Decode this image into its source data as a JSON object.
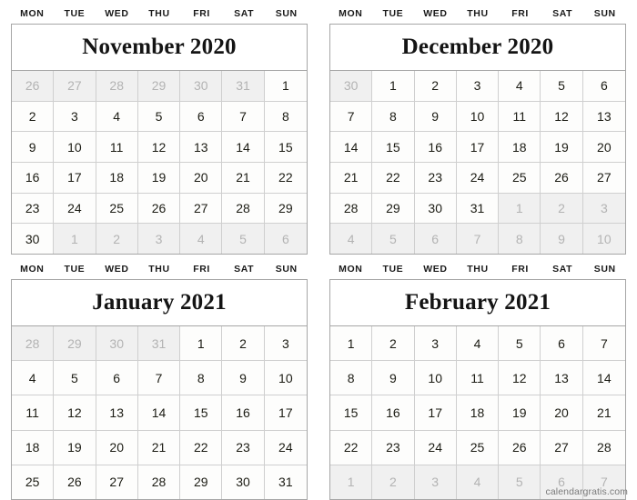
{
  "weekdays": [
    "MON",
    "TUE",
    "WED",
    "THU",
    "FRI",
    "SAT",
    "SUN"
  ],
  "watermark": "calendargratis.com",
  "colors": {
    "box_border": "#a6a6a6",
    "cell_border": "#cfcfcf",
    "out_of_month_bg": "#f0f0f0",
    "out_of_month_text": "#b3b3b3",
    "in_month_text": "#1c1c14",
    "title_text": "#141414",
    "page_bg": "#ffffff",
    "watermark_text": "#7a7a7a"
  },
  "months": [
    {
      "id": "november-2020",
      "title": "November 2020",
      "month_name": "November",
      "year": "2020",
      "weeks": [
        [
          {
            "n": "26",
            "out": true
          },
          {
            "n": "27",
            "out": true
          },
          {
            "n": "28",
            "out": true
          },
          {
            "n": "29",
            "out": true
          },
          {
            "n": "30",
            "out": true
          },
          {
            "n": "31",
            "out": true
          },
          {
            "n": "1",
            "out": false
          }
        ],
        [
          {
            "n": "2",
            "out": false
          },
          {
            "n": "3",
            "out": false
          },
          {
            "n": "4",
            "out": false
          },
          {
            "n": "5",
            "out": false
          },
          {
            "n": "6",
            "out": false
          },
          {
            "n": "7",
            "out": false
          },
          {
            "n": "8",
            "out": false
          }
        ],
        [
          {
            "n": "9",
            "out": false
          },
          {
            "n": "10",
            "out": false
          },
          {
            "n": "11",
            "out": false
          },
          {
            "n": "12",
            "out": false
          },
          {
            "n": "13",
            "out": false
          },
          {
            "n": "14",
            "out": false
          },
          {
            "n": "15",
            "out": false
          }
        ],
        [
          {
            "n": "16",
            "out": false
          },
          {
            "n": "17",
            "out": false
          },
          {
            "n": "18",
            "out": false
          },
          {
            "n": "19",
            "out": false
          },
          {
            "n": "20",
            "out": false
          },
          {
            "n": "21",
            "out": false
          },
          {
            "n": "22",
            "out": false
          }
        ],
        [
          {
            "n": "23",
            "out": false
          },
          {
            "n": "24",
            "out": false
          },
          {
            "n": "25",
            "out": false
          },
          {
            "n": "26",
            "out": false
          },
          {
            "n": "27",
            "out": false
          },
          {
            "n": "28",
            "out": false
          },
          {
            "n": "29",
            "out": false
          }
        ],
        [
          {
            "n": "30",
            "out": false
          },
          {
            "n": "1",
            "out": true
          },
          {
            "n": "2",
            "out": true
          },
          {
            "n": "3",
            "out": true
          },
          {
            "n": "4",
            "out": true
          },
          {
            "n": "5",
            "out": true
          },
          {
            "n": "6",
            "out": true
          }
        ]
      ]
    },
    {
      "id": "december-2020",
      "title": "December 2020",
      "month_name": "December",
      "year": "2020",
      "weeks": [
        [
          {
            "n": "30",
            "out": true
          },
          {
            "n": "1",
            "out": false
          },
          {
            "n": "2",
            "out": false
          },
          {
            "n": "3",
            "out": false
          },
          {
            "n": "4",
            "out": false
          },
          {
            "n": "5",
            "out": false
          },
          {
            "n": "6",
            "out": false
          }
        ],
        [
          {
            "n": "7",
            "out": false
          },
          {
            "n": "8",
            "out": false
          },
          {
            "n": "9",
            "out": false
          },
          {
            "n": "10",
            "out": false
          },
          {
            "n": "11",
            "out": false
          },
          {
            "n": "12",
            "out": false
          },
          {
            "n": "13",
            "out": false
          }
        ],
        [
          {
            "n": "14",
            "out": false
          },
          {
            "n": "15",
            "out": false
          },
          {
            "n": "16",
            "out": false
          },
          {
            "n": "17",
            "out": false
          },
          {
            "n": "18",
            "out": false
          },
          {
            "n": "19",
            "out": false
          },
          {
            "n": "20",
            "out": false
          }
        ],
        [
          {
            "n": "21",
            "out": false
          },
          {
            "n": "22",
            "out": false
          },
          {
            "n": "23",
            "out": false
          },
          {
            "n": "24",
            "out": false
          },
          {
            "n": "25",
            "out": false
          },
          {
            "n": "26",
            "out": false
          },
          {
            "n": "27",
            "out": false
          }
        ],
        [
          {
            "n": "28",
            "out": false
          },
          {
            "n": "29",
            "out": false
          },
          {
            "n": "30",
            "out": false
          },
          {
            "n": "31",
            "out": false
          },
          {
            "n": "1",
            "out": true
          },
          {
            "n": "2",
            "out": true
          },
          {
            "n": "3",
            "out": true
          }
        ],
        [
          {
            "n": "4",
            "out": true
          },
          {
            "n": "5",
            "out": true
          },
          {
            "n": "6",
            "out": true
          },
          {
            "n": "7",
            "out": true
          },
          {
            "n": "8",
            "out": true
          },
          {
            "n": "9",
            "out": true
          },
          {
            "n": "10",
            "out": true
          }
        ]
      ]
    },
    {
      "id": "january-2021",
      "title": "January 2021",
      "month_name": "January",
      "year": "2021",
      "weeks": [
        [
          {
            "n": "28",
            "out": true
          },
          {
            "n": "29",
            "out": true
          },
          {
            "n": "30",
            "out": true
          },
          {
            "n": "31",
            "out": true
          },
          {
            "n": "1",
            "out": false
          },
          {
            "n": "2",
            "out": false
          },
          {
            "n": "3",
            "out": false
          }
        ],
        [
          {
            "n": "4",
            "out": false
          },
          {
            "n": "5",
            "out": false
          },
          {
            "n": "6",
            "out": false
          },
          {
            "n": "7",
            "out": false
          },
          {
            "n": "8",
            "out": false
          },
          {
            "n": "9",
            "out": false
          },
          {
            "n": "10",
            "out": false
          }
        ],
        [
          {
            "n": "11",
            "out": false
          },
          {
            "n": "12",
            "out": false
          },
          {
            "n": "13",
            "out": false
          },
          {
            "n": "14",
            "out": false
          },
          {
            "n": "15",
            "out": false
          },
          {
            "n": "16",
            "out": false
          },
          {
            "n": "17",
            "out": false
          }
        ],
        [
          {
            "n": "18",
            "out": false
          },
          {
            "n": "19",
            "out": false
          },
          {
            "n": "20",
            "out": false
          },
          {
            "n": "21",
            "out": false
          },
          {
            "n": "22",
            "out": false
          },
          {
            "n": "23",
            "out": false
          },
          {
            "n": "24",
            "out": false
          }
        ],
        [
          {
            "n": "25",
            "out": false
          },
          {
            "n": "26",
            "out": false
          },
          {
            "n": "27",
            "out": false
          },
          {
            "n": "28",
            "out": false
          },
          {
            "n": "29",
            "out": false
          },
          {
            "n": "30",
            "out": false
          },
          {
            "n": "31",
            "out": false
          }
        ]
      ]
    },
    {
      "id": "february-2021",
      "title": "February 2021",
      "month_name": "February",
      "year": "2021",
      "weeks": [
        [
          {
            "n": "1",
            "out": false
          },
          {
            "n": "2",
            "out": false
          },
          {
            "n": "3",
            "out": false
          },
          {
            "n": "4",
            "out": false
          },
          {
            "n": "5",
            "out": false
          },
          {
            "n": "6",
            "out": false
          },
          {
            "n": "7",
            "out": false
          }
        ],
        [
          {
            "n": "8",
            "out": false
          },
          {
            "n": "9",
            "out": false
          },
          {
            "n": "10",
            "out": false
          },
          {
            "n": "11",
            "out": false
          },
          {
            "n": "12",
            "out": false
          },
          {
            "n": "13",
            "out": false
          },
          {
            "n": "14",
            "out": false
          }
        ],
        [
          {
            "n": "15",
            "out": false
          },
          {
            "n": "16",
            "out": false
          },
          {
            "n": "17",
            "out": false
          },
          {
            "n": "18",
            "out": false
          },
          {
            "n": "19",
            "out": false
          },
          {
            "n": "20",
            "out": false
          },
          {
            "n": "21",
            "out": false
          }
        ],
        [
          {
            "n": "22",
            "out": false
          },
          {
            "n": "23",
            "out": false
          },
          {
            "n": "24",
            "out": false
          },
          {
            "n": "25",
            "out": false
          },
          {
            "n": "26",
            "out": false
          },
          {
            "n": "27",
            "out": false
          },
          {
            "n": "28",
            "out": false
          }
        ],
        [
          {
            "n": "1",
            "out": true
          },
          {
            "n": "2",
            "out": true
          },
          {
            "n": "3",
            "out": true
          },
          {
            "n": "4",
            "out": true
          },
          {
            "n": "5",
            "out": true
          },
          {
            "n": "6",
            "out": true
          },
          {
            "n": "7",
            "out": true
          }
        ]
      ]
    }
  ]
}
